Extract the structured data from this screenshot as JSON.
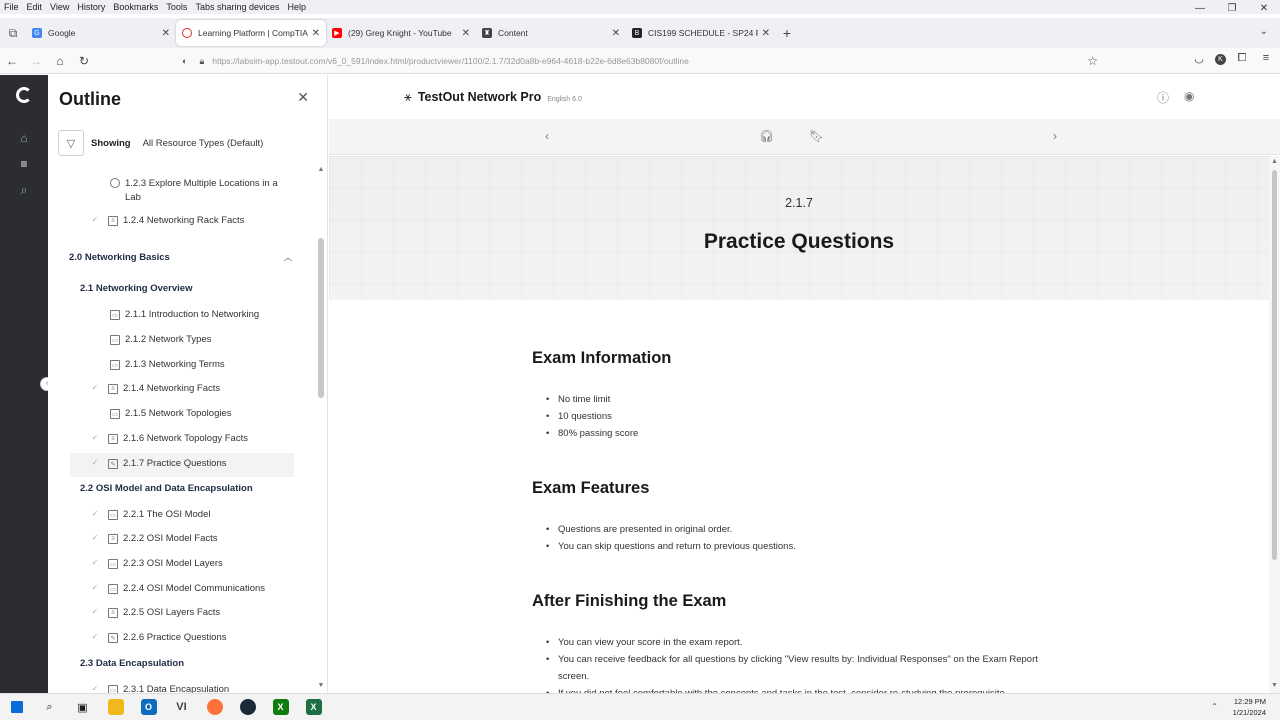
{
  "menubar": [
    "File",
    "Edit",
    "View",
    "History",
    "Bookmarks",
    "Tools",
    "Tabs sharing devices",
    "Help"
  ],
  "tabs": [
    {
      "title": "Google",
      "favicon_color": "#4285f4",
      "favicon": "G",
      "active": false
    },
    {
      "title": "Learning Platform | CompTIA",
      "favicon_color": "#d93025",
      "favicon": "C",
      "active": true
    },
    {
      "title": "(29) Greg Knight - YouTube",
      "favicon_color": "#ff0000",
      "favicon": "▶",
      "active": false
    },
    {
      "title": "Content",
      "favicon_color": "#444444",
      "favicon": "♜",
      "active": false
    },
    {
      "title": "CIS199 SCHEDULE - SP24 Rev 1",
      "favicon_color": "#222222",
      "favicon": "B",
      "active": false
    }
  ],
  "url": "https://labsim-app.testout.com/v6_0_591/index.html/productviewer/1100/2.1.7/32d0a8b-e964-4618-b22e-6d8e63b8080f/outline",
  "outline": {
    "title": "Outline",
    "filter_label": "Showing",
    "filter_value": "All Resource Types (Default)",
    "items": [
      {
        "label": "1.2.3 Explore Multiple Locations in a Lab",
        "kind": "lab",
        "level": 2,
        "checked": false
      },
      {
        "label": "1.2.4 Networking Rack Facts",
        "kind": "doc",
        "level": 2,
        "checked": true
      },
      {
        "label": "2.0 Networking Basics",
        "kind": "chapter",
        "level": 0
      },
      {
        "label": "2.1 Networking Overview",
        "kind": "section",
        "level": 1
      },
      {
        "label": "2.1.1 Introduction to Networking",
        "kind": "video",
        "level": 2,
        "checked": false
      },
      {
        "label": "2.1.2 Network Types",
        "kind": "video",
        "level": 2,
        "checked": false
      },
      {
        "label": "2.1.3 Networking Terms",
        "kind": "video",
        "level": 2,
        "checked": false
      },
      {
        "label": "2.1.4 Networking Facts",
        "kind": "doc",
        "level": 2,
        "checked": true
      },
      {
        "label": "2.1.5 Network Topologies",
        "kind": "video",
        "level": 2,
        "checked": false
      },
      {
        "label": "2.1.6 Network Topology Facts",
        "kind": "doc",
        "level": 2,
        "checked": true
      },
      {
        "label": "2.1.7 Practice Questions",
        "kind": "quiz",
        "level": 2,
        "checked": true,
        "current": true
      },
      {
        "label": "2.2 OSI Model and Data Encapsulation",
        "kind": "section",
        "level": 1
      },
      {
        "label": "2.2.1 The OSI Model",
        "kind": "video",
        "level": 2,
        "checked": true
      },
      {
        "label": "2.2.2 OSI Model Facts",
        "kind": "doc",
        "level": 2,
        "checked": true
      },
      {
        "label": "2.2.3 OSI Model Layers",
        "kind": "video",
        "level": 2,
        "checked": true
      },
      {
        "label": "2.2.4 OSI Model Communications",
        "kind": "video",
        "level": 2,
        "checked": true
      },
      {
        "label": "2.2.5 OSI Layers Facts",
        "kind": "doc",
        "level": 2,
        "checked": true
      },
      {
        "label": "2.2.6 Practice Questions",
        "kind": "quiz",
        "level": 2,
        "checked": true
      },
      {
        "label": "2.3 Data Encapsulation",
        "kind": "section",
        "level": 1
      },
      {
        "label": "2.3.1 Data Encapsulation",
        "kind": "video",
        "level": 2,
        "checked": true
      }
    ]
  },
  "brand": {
    "name": "TestOut Network Pro",
    "lang": "English 6.0"
  },
  "lesson": {
    "number": "2.1.7",
    "title": "Practice Questions"
  },
  "sections": [
    {
      "heading": "Exam Information",
      "bullets": [
        "No time limit",
        "10 questions",
        "80% passing score"
      ]
    },
    {
      "heading": "Exam Features",
      "bullets": [
        "Questions are presented in original order.",
        "You can skip questions and return to previous questions."
      ]
    },
    {
      "heading": "After Finishing the Exam",
      "bullets": [
        "You can view your score in the exam report.",
        "You can receive feedback for all questions by clicking \"View results by: Individual Responses\" on the Exam Report screen.",
        "If you did not feel comfortable with the concepts and tasks in the test, consider re-studying the prerequisite"
      ]
    }
  ],
  "taskbar": {
    "time": "12:29 PM",
    "date": "1/21/2024"
  }
}
